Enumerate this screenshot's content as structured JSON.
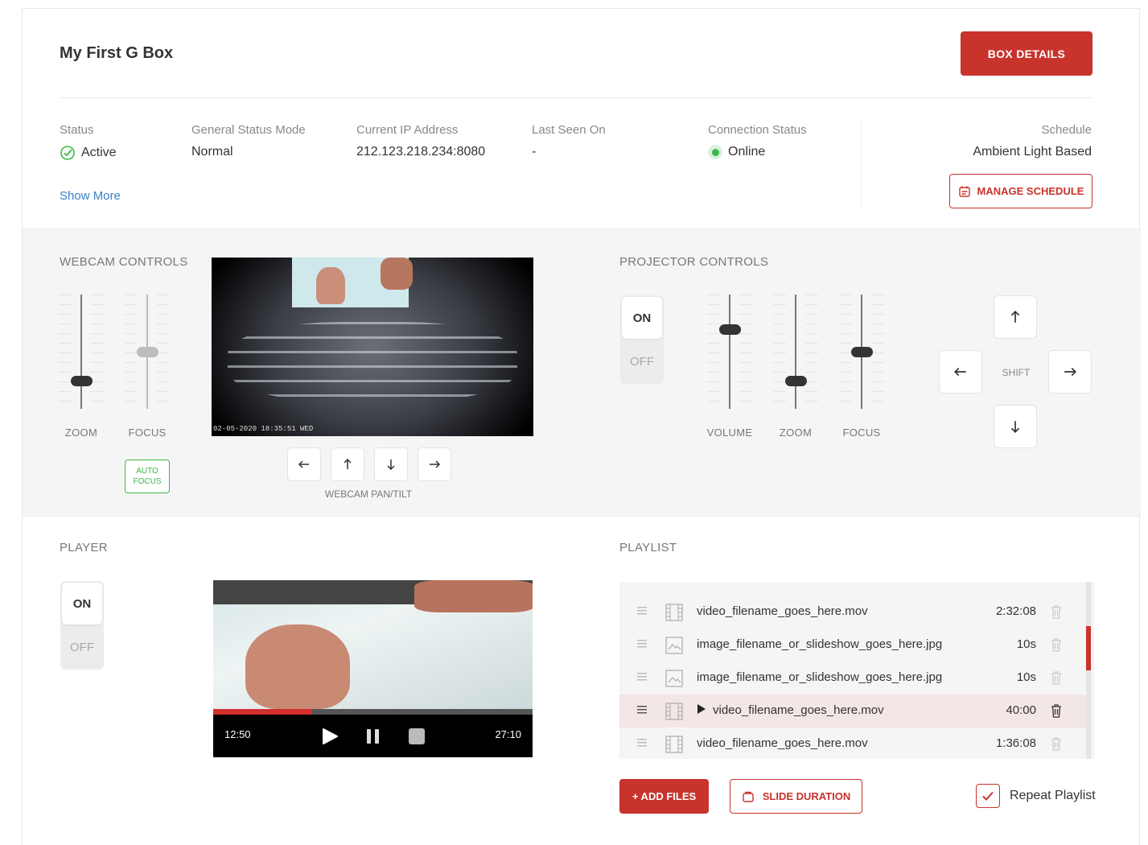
{
  "header": {
    "title": "My First G Box",
    "details_button": "BOX DETAILS"
  },
  "status": {
    "fields": [
      {
        "label": "Status",
        "value": "Active"
      },
      {
        "label": "General Status Mode",
        "value": "Normal"
      },
      {
        "label": "Current IP Address",
        "value": "212.123.218.234:8080"
      },
      {
        "label": "Last Seen On",
        "value": "-"
      },
      {
        "label": "Connection Status",
        "value": "Online"
      }
    ],
    "show_more": "Show More",
    "schedule_label": "Schedule",
    "schedule_value": "Ambient Light Based",
    "manage_schedule": "MANAGE SCHEDULE"
  },
  "webcam": {
    "section_title": "WEBCAM CONTROLS",
    "zoom_label": "ZOOM",
    "zoom_level": 0.22,
    "focus_label": "FOCUS",
    "focus_level": 0.5,
    "auto_focus": "AUTO FOCUS",
    "timestamp": "02-05-2020 18:35:51 WED",
    "pan_tilt_label": "WEBCAM PAN/TILT"
  },
  "projector": {
    "section_title": "PROJECTOR CONTROLS",
    "toggle_on": "ON",
    "toggle_off": "OFF",
    "volume_label": "VOLUME",
    "volume_level": 0.71,
    "zoom_label": "ZOOM",
    "zoom_level": 0.22,
    "focus_label": "FOCUS",
    "focus_level": 0.5,
    "shift_label": "SHIFT"
  },
  "player": {
    "section_title": "PLAYER",
    "toggle_on": "ON",
    "toggle_off": "OFF",
    "current_time": "12:50",
    "total_time": "27:10",
    "progress": 0.31
  },
  "playlist": {
    "section_title": "PLAYLIST",
    "items": [
      {
        "type": "video",
        "name": "video_filename_goes_here.mov",
        "duration": "2:32:08",
        "playing": false
      },
      {
        "type": "image",
        "name": "image_filename_or_slideshow_goes_here.jpg",
        "duration": "10s",
        "playing": false
      },
      {
        "type": "image",
        "name": "image_filename_or_slideshow_goes_here.jpg",
        "duration": "10s",
        "playing": false
      },
      {
        "type": "video",
        "name": "video_filename_goes_here.mov",
        "duration": "40:00",
        "playing": true
      },
      {
        "type": "video",
        "name": "video_filename_goes_here.mov",
        "duration": "1:36:08",
        "playing": false
      }
    ],
    "add_files": "+ ADD FILES",
    "slide_duration": "SLIDE DURATION",
    "repeat_label": "Repeat Playlist",
    "repeat_checked": true
  },
  "colors": {
    "accent": "#c8332c",
    "success": "#3cb84a",
    "link": "#3b7fc4"
  }
}
